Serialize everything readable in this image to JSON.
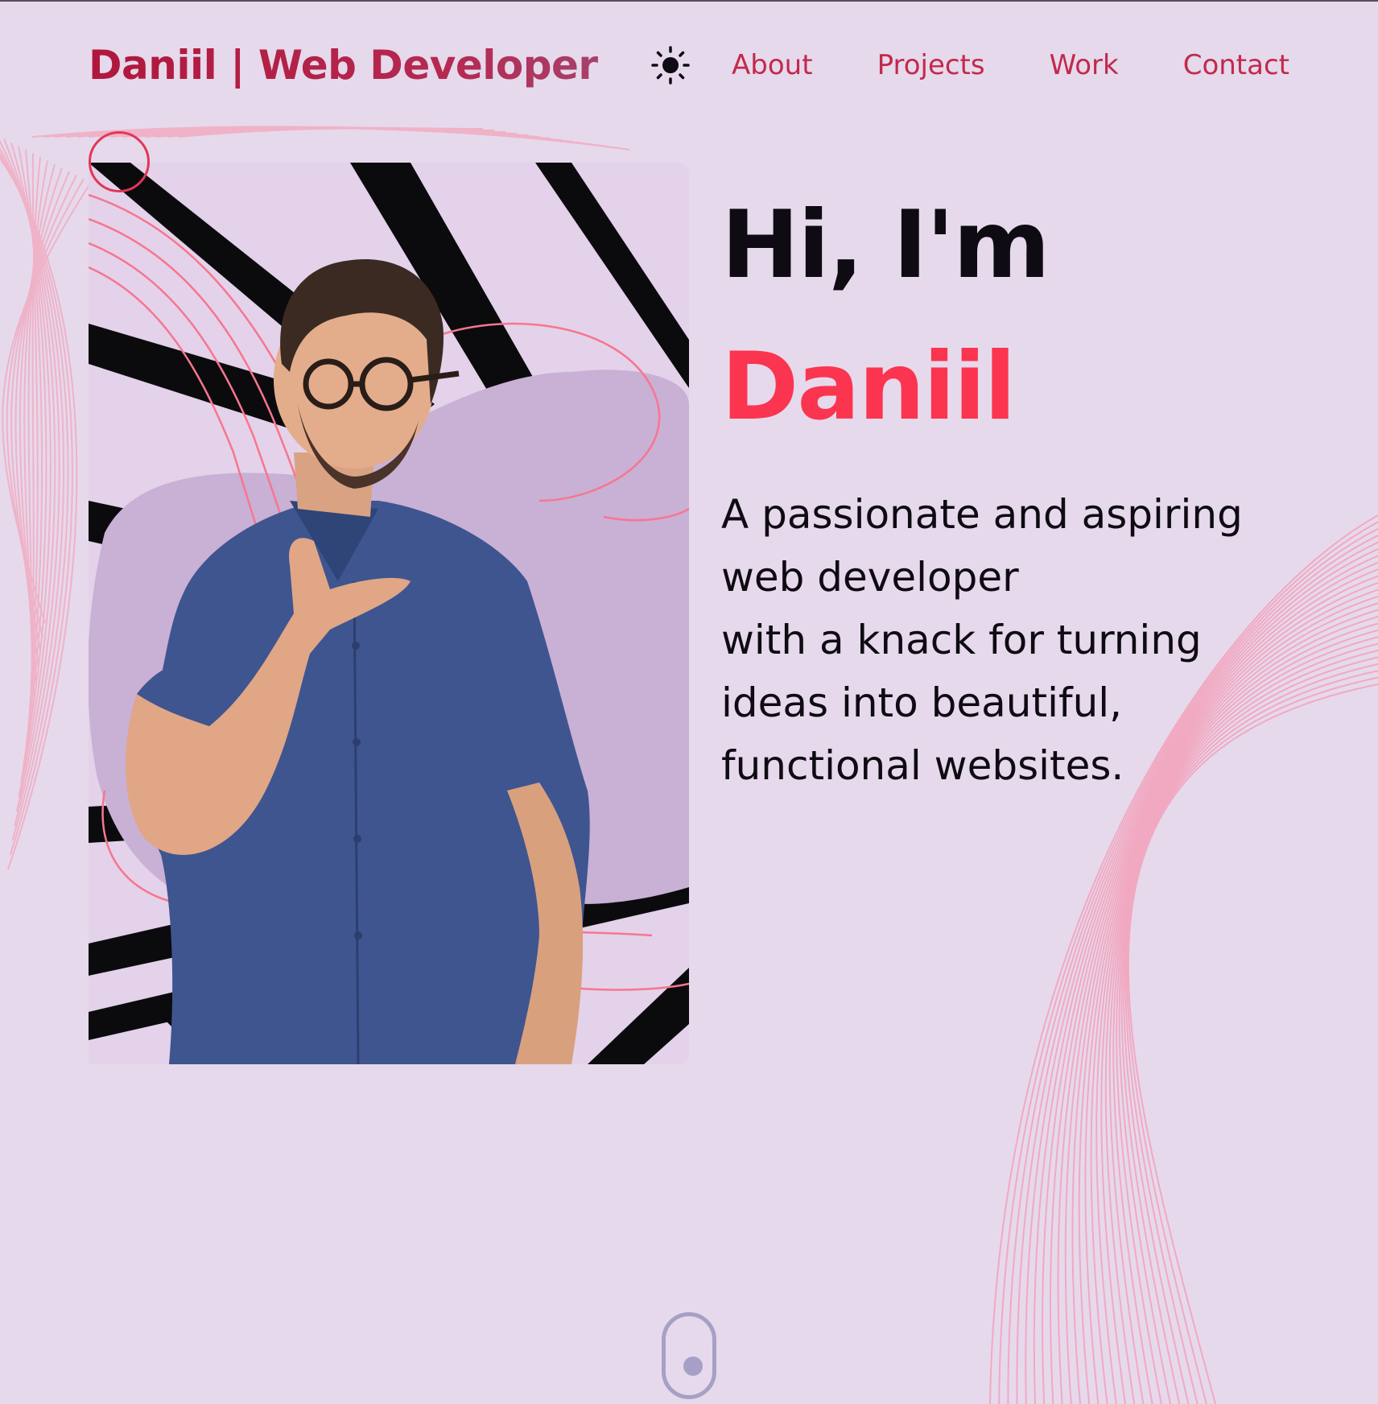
{
  "header": {
    "brand": "Daniil | Web Developer",
    "theme_toggle_icon": "sun-icon",
    "nav": [
      "About",
      "Projects",
      "Work",
      "Contact"
    ]
  },
  "hero": {
    "greeting": "Hi, I'm",
    "name": "Daniil",
    "tagline_lines": [
      "A passionate and aspiring",
      "web developer",
      "with a knack for turning",
      "ideas into beautiful,",
      "functional websites."
    ],
    "photo_icon": "portrait-photo"
  },
  "scroll_icon": "mouse-scroll-icon",
  "colors": {
    "background": "#e6d9ec",
    "accent": "#fb3450",
    "brand": "#b0173c",
    "nav": "#c2294b",
    "text": "#0e0b12",
    "scroll": "#a6a0c6"
  }
}
